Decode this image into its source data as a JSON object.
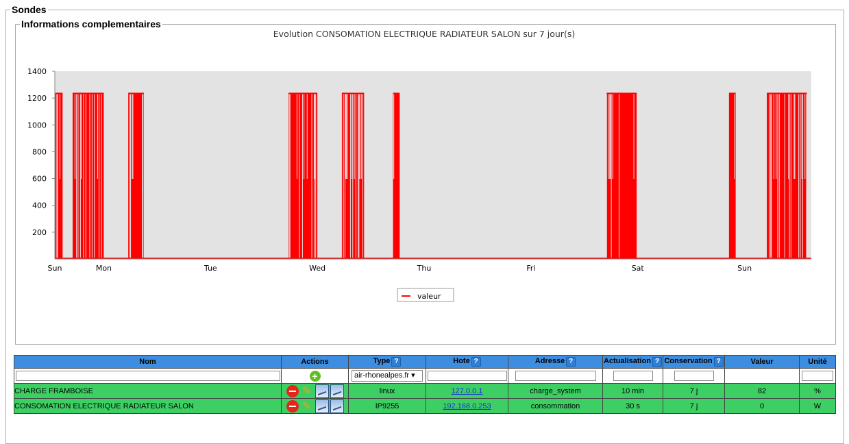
{
  "sections": {
    "outer_legend": "Sondes",
    "inner_legend": "Informations complementaires"
  },
  "chart_data": {
    "type": "line",
    "title": "Evolution CONSOMATION ELECTRIQUE RADIATEUR SALON sur 7 jour(s)",
    "xlabel": "",
    "ylabel": "",
    "ylim": [
      0,
      1400
    ],
    "yticks": [
      200,
      400,
      600,
      800,
      1000,
      1200,
      1400
    ],
    "xticks": [
      {
        "label": "Sun",
        "hour": 0
      },
      {
        "label": "Mon",
        "hour": 22
      },
      {
        "label": "Tue",
        "hour": 70
      },
      {
        "label": "Wed",
        "hour": 118
      },
      {
        "label": "Thu",
        "hour": 166
      },
      {
        "label": "Fri",
        "hour": 214
      },
      {
        "label": "Sat",
        "hour": 262
      },
      {
        "label": "Sun",
        "hour": 310
      }
    ],
    "xrange_hours": [
      0,
      340
    ],
    "background": "#e3e3e3",
    "grid": false,
    "legend_position": "bottom-center",
    "series": [
      {
        "name": "valeur",
        "color": "#ff0000",
        "baseline": 0,
        "on_level": 1240,
        "active_periods_hours": [
          [
            0.2,
            3.5
          ],
          [
            8,
            22
          ],
          [
            33,
            40
          ],
          [
            105,
            118
          ],
          [
            129,
            139
          ],
          [
            152,
            155
          ],
          [
            248,
            261.5
          ],
          [
            303,
            306
          ],
          [
            320,
            338
          ]
        ]
      }
    ]
  },
  "table": {
    "headers": {
      "nom": "Nom",
      "actions": "Actions",
      "type": "Type",
      "hote": "Hote",
      "adresse": "Adresse",
      "actualisation": "Actualisation",
      "conservation": "Conservation",
      "valeur": "Valeur",
      "unite": "Unité"
    },
    "help_glyph": "?",
    "add_glyph": "+",
    "filter": {
      "type_selected": "air-rhonealpes.fr",
      "select_arrow": "▾"
    },
    "rows": [
      {
        "nom": "CHARGE FRAMBOISE",
        "type": "linux",
        "hote": "127.0.0.1",
        "adresse": "charge_system",
        "actualisation": "10 min",
        "conservation": "7 j",
        "valeur": "82",
        "unite": "%"
      },
      {
        "nom": "CONSOMATION ELECTRIQUE RADIATEUR SALON",
        "type": "IP9255",
        "hote": "192.168.0.253",
        "adresse": "consommation",
        "actualisation": "30 s",
        "conservation": "7 j",
        "valeur": "0",
        "unite": "W"
      }
    ],
    "icons": {
      "delete": "delete-icon",
      "edit": "pencil-icon",
      "graph": "graph-icon",
      "add": "add-circle-icon"
    }
  }
}
